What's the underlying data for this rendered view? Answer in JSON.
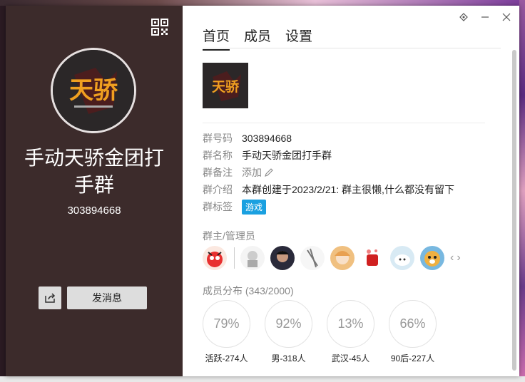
{
  "left": {
    "group_name": "手动天骄金团打手群",
    "group_id": "303894668",
    "send_message": "发消息",
    "logo_text": "天骄"
  },
  "tabs": [
    {
      "label": "首页",
      "active": true
    },
    {
      "label": "成员",
      "active": false
    },
    {
      "label": "设置",
      "active": false
    }
  ],
  "info": {
    "id_label": "群号码",
    "id_value": "303894668",
    "name_label": "群名称",
    "name_value": "手动天骄金团打手群",
    "remark_label": "群备注",
    "remark_value": "添加",
    "intro_label": "群介绍",
    "intro_value": "本群创建于2023/2/21:  群主很懒,什么都没有留下",
    "tags_label": "群标签",
    "tag_value": "游戏"
  },
  "admins_title": "群主/管理员",
  "distribution": {
    "title": "成员分布 (343/2000)",
    "items": [
      {
        "value": "79%",
        "label": "活跃-274人"
      },
      {
        "value": "92%",
        "label": "男-318人"
      },
      {
        "value": "13%",
        "label": "武汉-45人"
      },
      {
        "value": "66%",
        "label": "90后-227人"
      }
    ]
  },
  "colors": {
    "left_panel": "#3c2b2b",
    "tag": "#1aa0e0"
  }
}
